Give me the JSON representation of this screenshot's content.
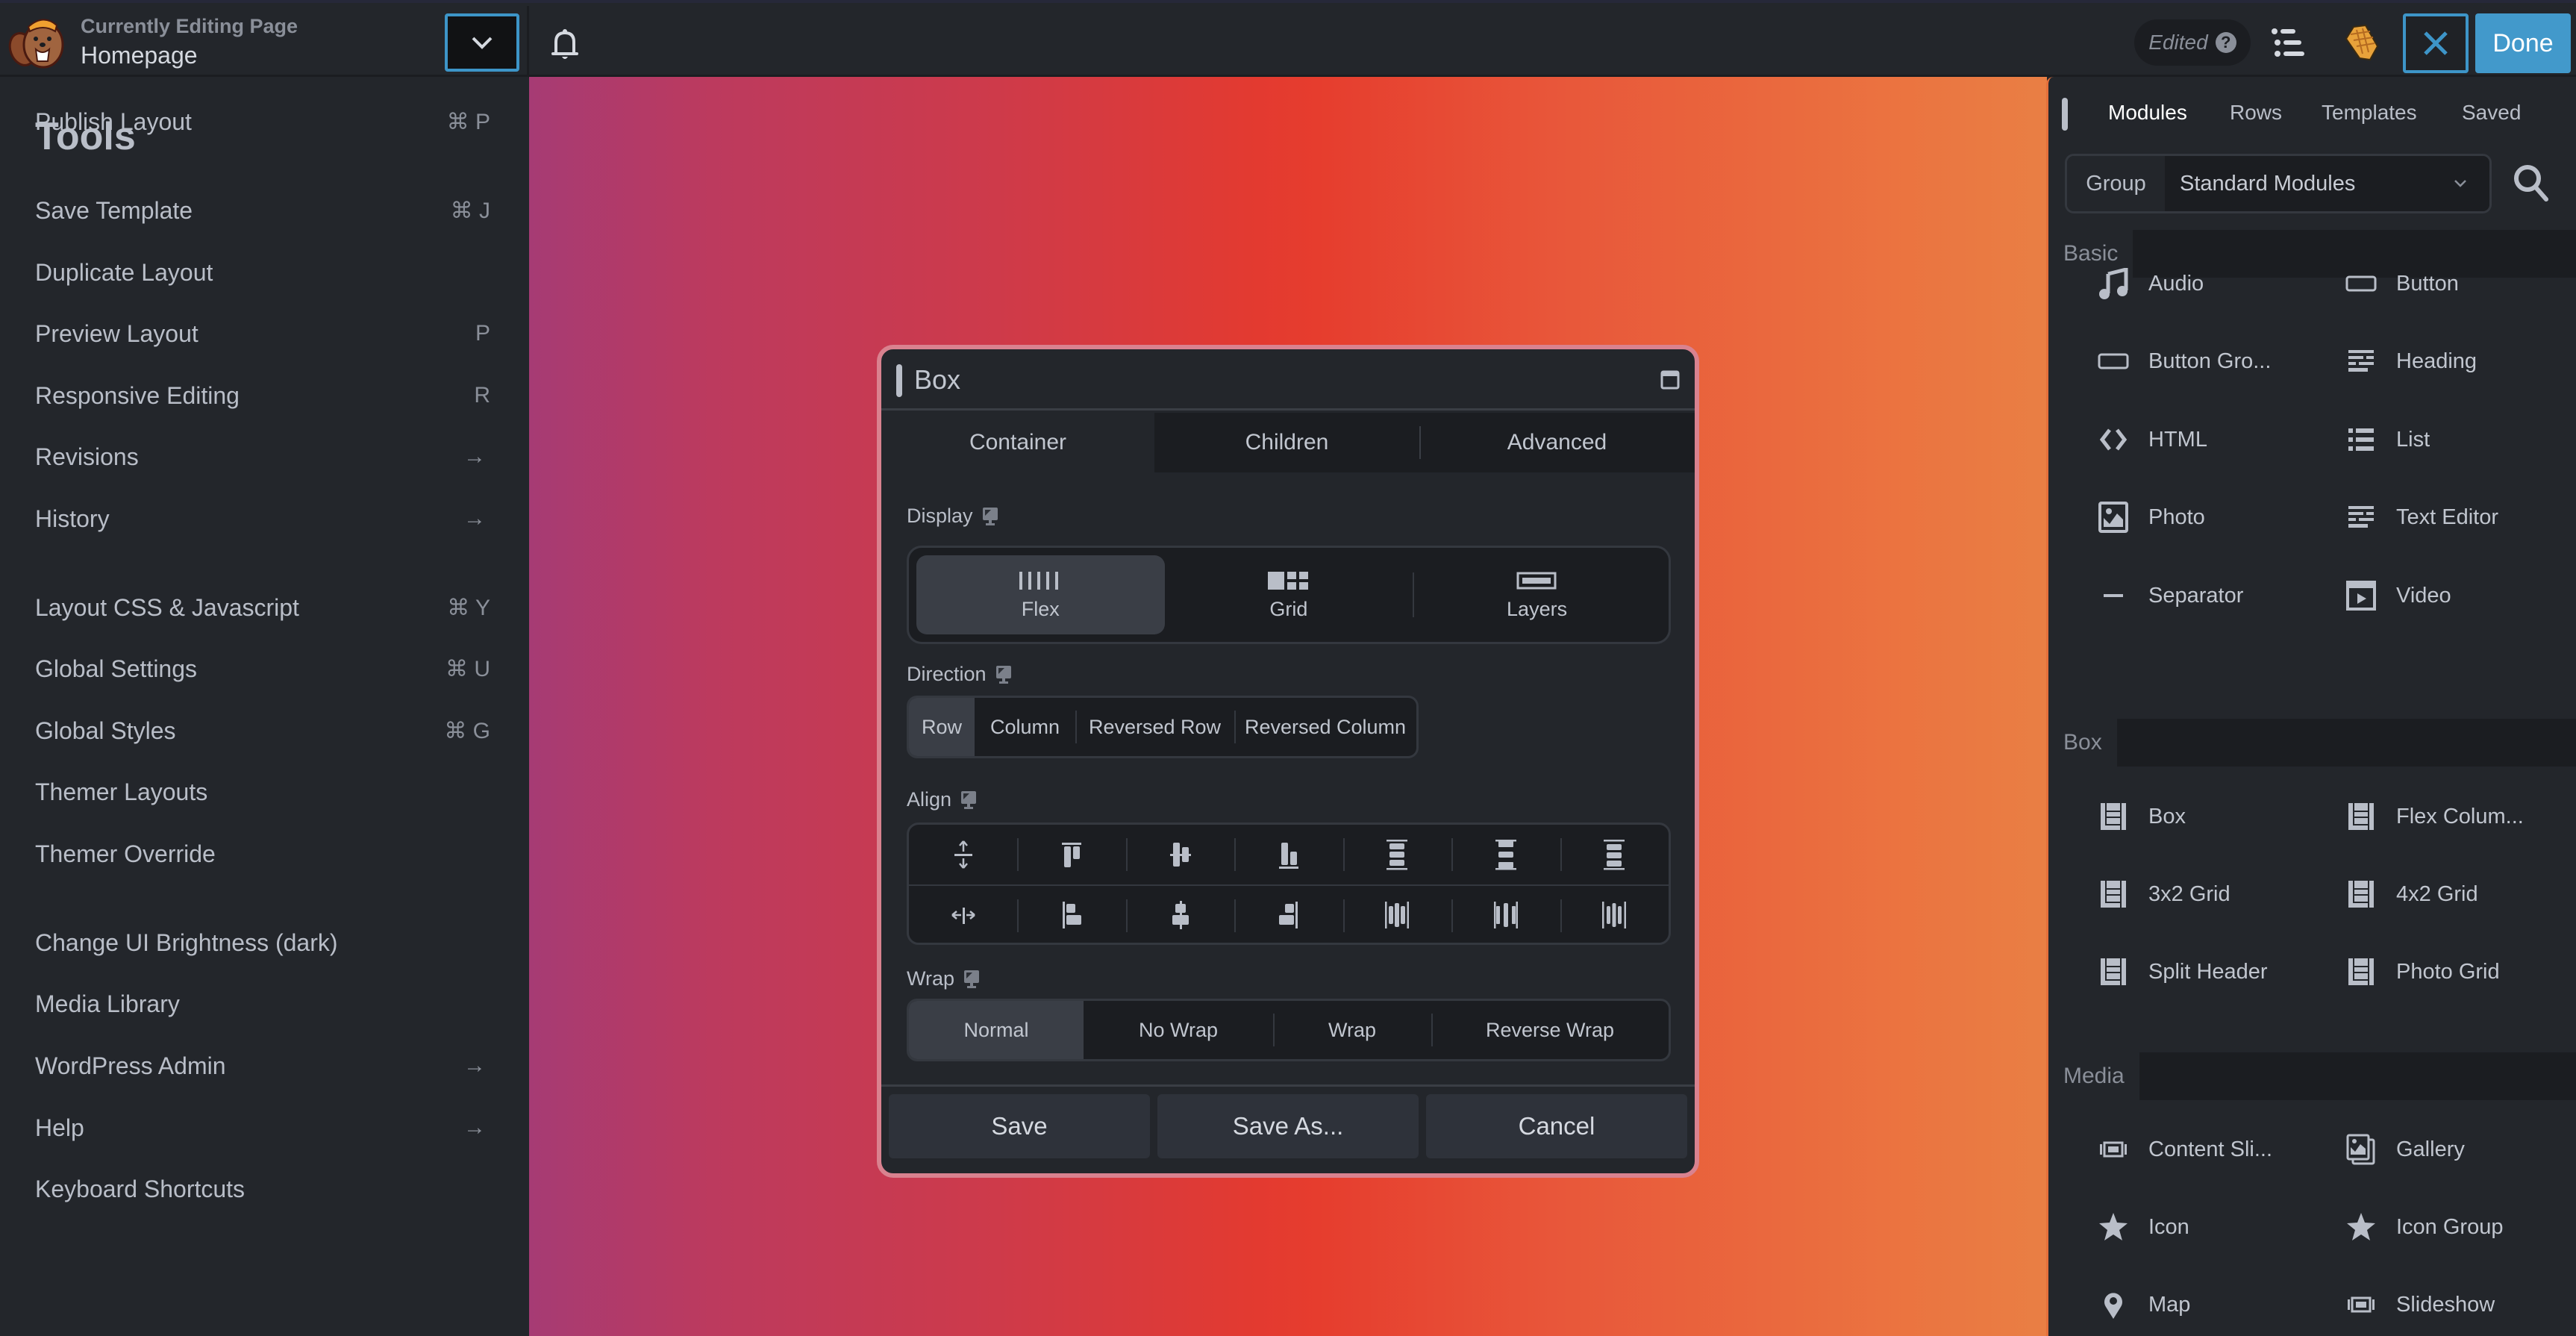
{
  "header": {
    "subtitle": "Currently Editing Page",
    "title": "Homepage",
    "status_badge": "Edited",
    "help_glyph": "?",
    "done_label": "Done",
    "icons": [
      "beaver-logo-icon",
      "chevron-down-icon",
      "bell-icon",
      "help-icon",
      "outline-list-icon",
      "pencil-icon",
      "close-icon"
    ]
  },
  "tools": {
    "title": "Tools",
    "items": [
      {
        "label": "Publish Layout",
        "shortcut": "⌘ P",
        "type": "shortcut"
      },
      {
        "label": "Save Template",
        "shortcut": "⌘ J",
        "type": "shortcut"
      },
      {
        "label": "Duplicate Layout",
        "shortcut": "",
        "type": "none"
      },
      {
        "label": "Preview Layout",
        "shortcut": "P",
        "type": "shortcut"
      },
      {
        "label": "Responsive Editing",
        "shortcut": "R",
        "type": "shortcut"
      },
      {
        "label": "Revisions",
        "shortcut": "→",
        "type": "arrow"
      },
      {
        "label": "History",
        "shortcut": "→",
        "type": "arrow"
      },
      {
        "label": "Layout CSS & Javascript",
        "shortcut": "⌘ Y",
        "type": "shortcut"
      },
      {
        "label": "Global Settings",
        "shortcut": "⌘ U",
        "type": "shortcut"
      },
      {
        "label": "Global Styles",
        "shortcut": "⌘ G",
        "type": "shortcut"
      },
      {
        "label": "Themer Layouts",
        "shortcut": "",
        "type": "none"
      },
      {
        "label": "Themer Override",
        "shortcut": "",
        "type": "none"
      },
      {
        "label": "Change UI Brightness (dark)",
        "shortcut": "",
        "type": "none"
      },
      {
        "label": "Media Library",
        "shortcut": "",
        "type": "none"
      },
      {
        "label": "WordPress Admin",
        "shortcut": "→",
        "type": "arrow"
      },
      {
        "label": "Help",
        "shortcut": "→",
        "type": "arrow"
      },
      {
        "label": "Keyboard Shortcuts",
        "shortcut": "",
        "type": "none"
      }
    ]
  },
  "canvas": {
    "gradient_colors": [
      "#a63b74",
      "#e33a30",
      "#e97f44"
    ]
  },
  "dialog": {
    "title": "Box",
    "tabs": [
      {
        "label": "Container",
        "active": true
      },
      {
        "label": "Children",
        "active": false
      },
      {
        "label": "Advanced",
        "active": false
      }
    ],
    "display": {
      "label": "Display",
      "options": [
        {
          "label": "Flex",
          "icon": "flex-icon",
          "active": true
        },
        {
          "label": "Grid",
          "icon": "grid-icon",
          "active": false
        },
        {
          "label": "Layers",
          "icon": "layers-icon",
          "active": false
        }
      ]
    },
    "direction": {
      "label": "Direction",
      "options": [
        {
          "label": "Row",
          "active": true
        },
        {
          "label": "Column",
          "active": false
        },
        {
          "label": "Reversed Row",
          "active": false
        },
        {
          "label": "Reversed Column",
          "active": false
        }
      ]
    },
    "align": {
      "label": "Align",
      "row1_icons": [
        "align-stretch-vertical-icon",
        "align-top-icon",
        "align-middle-icon",
        "align-bottom-icon",
        "space-between-vertical-icon",
        "space-around-vertical-icon",
        "space-evenly-vertical-icon"
      ],
      "row2_icons": [
        "align-stretch-horizontal-icon",
        "align-left-icon",
        "align-center-icon",
        "align-right-icon",
        "space-between-horizontal-icon",
        "space-around-horizontal-icon",
        "space-evenly-horizontal-icon"
      ]
    },
    "wrap": {
      "label": "Wrap",
      "options": [
        {
          "label": "Normal",
          "active": true
        },
        {
          "label": "No Wrap",
          "active": false
        },
        {
          "label": "Wrap",
          "active": false
        },
        {
          "label": "Reverse Wrap",
          "active": false
        }
      ]
    },
    "footer": {
      "save": "Save",
      "save_as": "Save As...",
      "cancel": "Cancel"
    }
  },
  "modules_panel": {
    "tabs": [
      {
        "label": "Modules",
        "active": true
      },
      {
        "label": "Rows",
        "active": false
      },
      {
        "label": "Templates",
        "active": false
      },
      {
        "label": "Saved",
        "active": false
      }
    ],
    "group_label": "Group",
    "group_value": "Standard Modules",
    "sections": [
      {
        "label": "Basic",
        "items": [
          {
            "label": "Audio",
            "icon": "music-note-icon"
          },
          {
            "label": "Button",
            "icon": "button-icon"
          },
          {
            "label": "Button Gro...",
            "icon": "button-group-icon"
          },
          {
            "label": "Heading",
            "icon": "heading-icon"
          },
          {
            "label": "HTML",
            "icon": "code-icon"
          },
          {
            "label": "List",
            "icon": "list-icon"
          },
          {
            "label": "Photo",
            "icon": "photo-icon"
          },
          {
            "label": "Text Editor",
            "icon": "text-editor-icon"
          },
          {
            "label": "Separator",
            "icon": "separator-icon"
          },
          {
            "label": "Video",
            "icon": "video-icon"
          }
        ]
      },
      {
        "label": "Box",
        "items": [
          {
            "label": "Box",
            "icon": "box-layout-icon"
          },
          {
            "label": "Flex Colum...",
            "icon": "box-layout-icon"
          },
          {
            "label": "3x2 Grid",
            "icon": "box-layout-icon"
          },
          {
            "label": "4x2 Grid",
            "icon": "box-layout-icon"
          },
          {
            "label": "Split Header",
            "icon": "box-layout-icon"
          },
          {
            "label": "Photo Grid",
            "icon": "box-layout-icon"
          }
        ]
      },
      {
        "label": "Media",
        "items": [
          {
            "label": "Content Sli...",
            "icon": "slider-icon"
          },
          {
            "label": "Gallery",
            "icon": "gallery-icon"
          },
          {
            "label": "Icon",
            "icon": "star-icon"
          },
          {
            "label": "Icon Group",
            "icon": "star-icon"
          },
          {
            "label": "Map",
            "icon": "map-pin-icon"
          },
          {
            "label": "Slideshow",
            "icon": "slider-icon"
          }
        ]
      }
    ]
  }
}
